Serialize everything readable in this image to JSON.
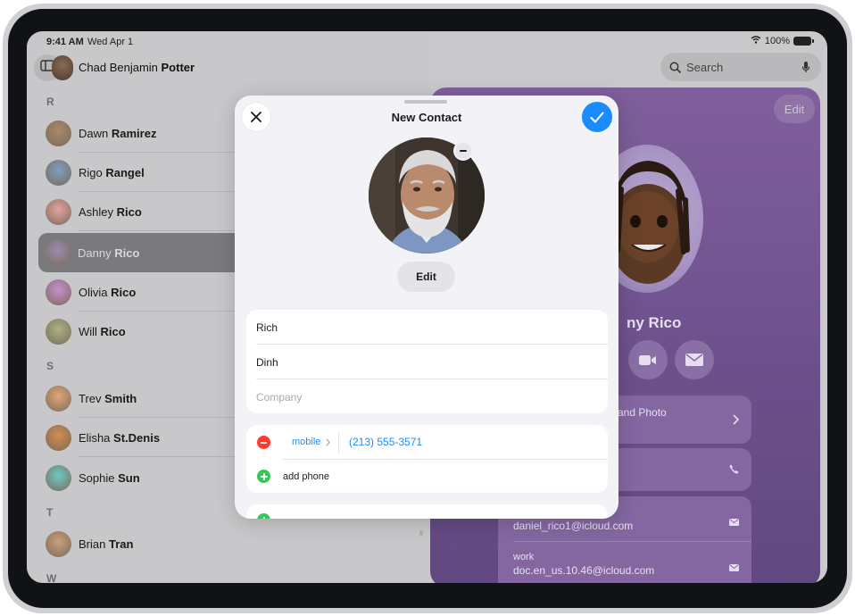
{
  "status": {
    "time": "9:41 AM",
    "date": "Wed Apr 1",
    "battery": "100%"
  },
  "me": {
    "first": "Chad Benjamin ",
    "last": "Potter"
  },
  "search": {
    "placeholder": "Search"
  },
  "contacts": {
    "sections": [
      {
        "letter": "R",
        "rows": [
          {
            "first": "Dawn ",
            "last": "Ramirez",
            "color": "#a98a6a"
          },
          {
            "first": "Rigo ",
            "last": "Rangel",
            "color": "#7d9fc0"
          },
          {
            "first": "Ashley ",
            "last": "Rico",
            "color": "#e3a4a0"
          },
          {
            "first": "Danny ",
            "last": "Rico",
            "color": "#9a8bb0",
            "selected": true
          },
          {
            "first": "Olivia ",
            "last": "Rico",
            "color": "#c98fd0"
          },
          {
            "first": "Will ",
            "last": "Rico",
            "color": "#aab384"
          }
        ]
      },
      {
        "letter": "S",
        "rows": [
          {
            "first": "Trev ",
            "last": "Smith",
            "color": "#e0a878"
          },
          {
            "first": "Elisha ",
            "last": "St.Denis",
            "color": "#d28e4e"
          },
          {
            "first": "Sophie ",
            "last": "Sun",
            "color": "#6fc8c4"
          }
        ]
      },
      {
        "letter": "T",
        "rows": [
          {
            "first": "Brian ",
            "last": "Tran",
            "color": "#c9a07c"
          }
        ]
      },
      {
        "letter": "W",
        "rows": []
      }
    ],
    "index_marker": "#"
  },
  "detail": {
    "edit_label": "Edit",
    "name": "ny Rico",
    "card_photo_label": "and Photo",
    "email1": "daniel_rico1@icloud.com",
    "email2_label": "work",
    "email2": "doc.en_us.10.46@icloud.com"
  },
  "modal": {
    "title": "New Contact",
    "edit_photo_label": "Edit",
    "first_name": "Rich",
    "last_name": "Dinh",
    "company_placeholder": "Company",
    "phone_type": "mobile",
    "phone_number": "(213) 555-3571",
    "add_phone_label": "add phone"
  },
  "colors": {
    "accent": "#1a8cff",
    "remove": "#ff3b30",
    "add": "#34c759",
    "detail_bg": "#6b4f8a"
  }
}
